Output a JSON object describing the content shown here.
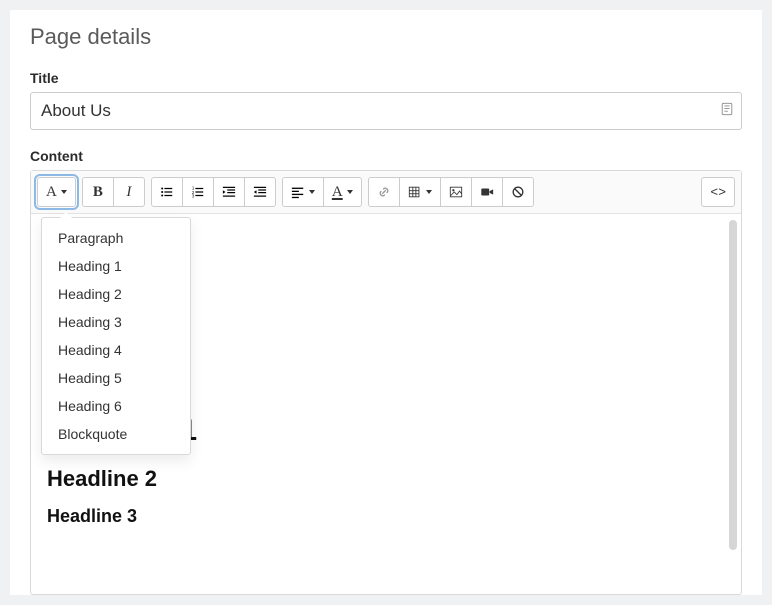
{
  "header": {
    "pageTitle": "Page details"
  },
  "fields": {
    "titleLabel": "Title",
    "titleValue": "About Us",
    "contentLabel": "Content"
  },
  "toolbar": {
    "styleGlyph": "A",
    "boldGlyph": "B",
    "italicGlyph": "I",
    "alignGlyph": "≡",
    "colorGlyph": "A",
    "codeGlyph": "<>"
  },
  "styleDropdown": {
    "items": [
      "Paragraph",
      "Heading 1",
      "Heading 2",
      "Heading 3",
      "Heading 4",
      "Heading 5",
      "Heading 6",
      "Blockquote"
    ]
  },
  "content": {
    "h1": "Headline 1",
    "h2": "Headline 2",
    "h3": "Headline 3"
  }
}
